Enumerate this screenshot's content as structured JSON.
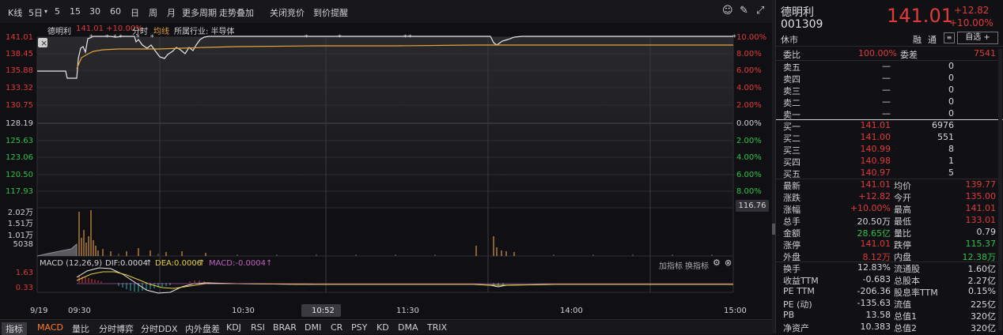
{
  "toolbar": {
    "items": [
      "K线",
      "5日",
      "5",
      "15",
      "30",
      "60",
      "日",
      "周",
      "月",
      "更多周期",
      "走势叠加",
      "关闭竞价",
      "到价提醒"
    ]
  },
  "chart": {
    "stock_name": "德明利",
    "price_pct": "141.01 +10.00%",
    "tab_fenshi": "分时",
    "tab_junxian": "均线",
    "industry": "所属行业: 半导体",
    "y_left": [
      "141.01",
      "138.45",
      "135.88",
      "133.32",
      "130.75",
      "128.19",
      "125.63",
      "123.06",
      "120.50",
      "117.93"
    ],
    "y_right": [
      "10.00%",
      "8.00%",
      "6.00%",
      "4.00%",
      "2.00%",
      "0.00%",
      "2.00%",
      "4.00%",
      "6.00%",
      "8.00%"
    ],
    "price_tag": "116.76",
    "vol_labels": [
      "2.02万",
      "1.51万",
      "1.01万",
      "5038"
    ],
    "macd_title": "MACD (12,26,9)",
    "dif": "DIF:0.0004",
    "dea": "DEA:0.0006",
    "macd_val": "MACD:-0.0004",
    "macd_y": [
      "1.63",
      "0.33"
    ],
    "add_indicator": "加指标",
    "change_indicator": "换指标",
    "date": "9/19",
    "times": [
      "09:30",
      "10:30",
      "11:30",
      "14:00",
      "15:00"
    ],
    "cursor_time": "10:52"
  },
  "bottom_tabs": [
    "指标",
    "MACD",
    "量比",
    "分时博弈",
    "分时DDX",
    "内外盘差",
    "KDJ",
    "RSI",
    "BRAR",
    "DMI",
    "CR",
    "PSY",
    "KD",
    "DMA",
    "TRIX"
  ],
  "quote": {
    "name": "德明利",
    "code": "001309",
    "status": "休市",
    "price": "141.01",
    "change": "+12.82",
    "change_pct": "+10.00%",
    "tags": [
      "融",
      "通"
    ],
    "watch": "自选 +",
    "weibi_label": "委比",
    "weibi": "100.00%",
    "weicha_label": "委差",
    "weicha": "7541",
    "sell": [
      {
        "label": "卖五",
        "price": "—",
        "vol": "0"
      },
      {
        "label": "卖四",
        "price": "—",
        "vol": "0"
      },
      {
        "label": "卖三",
        "price": "—",
        "vol": "0"
      },
      {
        "label": "卖二",
        "price": "—",
        "vol": "0"
      },
      {
        "label": "卖一",
        "price": "—",
        "vol": "0"
      }
    ],
    "buy": [
      {
        "label": "买一",
        "price": "141.01",
        "vol": "6976"
      },
      {
        "label": "买二",
        "price": "141.00",
        "vol": "551"
      },
      {
        "label": "买三",
        "price": "140.99",
        "vol": "8"
      },
      {
        "label": "买四",
        "price": "140.98",
        "vol": "1"
      },
      {
        "label": "买五",
        "price": "140.97",
        "vol": "5"
      }
    ],
    "stats": [
      {
        "l1": "最新",
        "v1": "141.01",
        "c1": "red",
        "l2": "均价",
        "v2": "139.77",
        "c2": "red"
      },
      {
        "l1": "涨跌",
        "v1": "+12.82",
        "c1": "red",
        "l2": "今开",
        "v2": "135.00",
        "c2": "red"
      },
      {
        "l1": "涨幅",
        "v1": "+10.00%",
        "c1": "red",
        "l2": "最高",
        "v2": "141.01",
        "c2": "red"
      },
      {
        "l1": "总手",
        "v1": "20.50万",
        "c1": "wht",
        "l2": "最低",
        "v2": "133.01",
        "c2": "red"
      },
      {
        "l1": "金额",
        "v1": "28.65亿",
        "c1": "grn",
        "l2": "量比",
        "v2": "0.79",
        "c2": "wht"
      },
      {
        "l1": "涨停",
        "v1": "141.01",
        "c1": "red",
        "l2": "跌停",
        "v2": "115.37",
        "c2": "grn"
      },
      {
        "l1": "外盘",
        "v1": "8.12万",
        "c1": "red",
        "l2": "内盘",
        "v2": "12.38万",
        "c2": "grn"
      }
    ],
    "fund": [
      {
        "l1": "换手",
        "v1": "12.83%",
        "l2": "流通股",
        "v2": "1.60亿"
      },
      {
        "l1": "收益TTM",
        "v1": "-0.683",
        "l2": "总股本",
        "v2": "2.27亿"
      },
      {
        "l1": "PE TTM",
        "v1": "-206.36",
        "l2": "股息率TTM",
        "v2": "0.15%"
      },
      {
        "l1": "PE (动)",
        "v1": "-135.63",
        "l2": "流值",
        "v2": "225亿"
      },
      {
        "l1": "PB",
        "v1": "13.58",
        "l2": "总值1",
        "v2": "320亿"
      },
      {
        "l1": "净资产",
        "v1": "10.383",
        "l2": "总值2",
        "v2": "320亿"
      }
    ]
  }
}
